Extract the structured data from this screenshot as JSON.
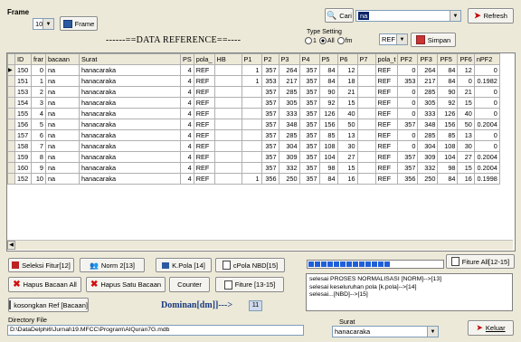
{
  "top": {
    "frame_label": "Frame",
    "frame_count": "10",
    "frame_button": "Frame",
    "cari_button": "Cari",
    "search_value": "na",
    "refresh_button": "Refresh",
    "data_reference_title": "------==DATA REFERENCE==----",
    "type_setting_label": "Type Setting",
    "radio_1": "1",
    "radio_all": "All",
    "radio_fm": "fm",
    "ref_select": "REF",
    "simpan_button": "Simpan"
  },
  "table": {
    "columns": [
      "ID",
      "frar",
      "bacaan",
      "Surat",
      "PS",
      "pola_",
      "HB",
      "P1",
      "P2",
      "P3",
      "P4",
      "P5",
      "P6",
      "P7",
      "pola_t",
      "PF2",
      "PF3",
      "PF5",
      "PF6",
      "nPF2"
    ],
    "rows": [
      [
        "150",
        "0",
        "na",
        "hanacaraka",
        "4",
        "REF",
        "",
        "1",
        "357",
        "264",
        "357",
        "84",
        "12",
        "",
        "REF",
        "0",
        "264",
        "84",
        "12",
        "0"
      ],
      [
        "151",
        "1",
        "na",
        "hanacaraka",
        "4",
        "REF",
        "",
        "1",
        "353",
        "217",
        "357",
        "84",
        "18",
        "",
        "REF",
        "353",
        "217",
        "84",
        "0",
        "0.1982"
      ],
      [
        "153",
        "2",
        "na",
        "hanacaraka",
        "4",
        "REF",
        "",
        "",
        "357",
        "285",
        "357",
        "90",
        "21",
        "",
        "REF",
        "0",
        "285",
        "90",
        "21",
        "0"
      ],
      [
        "154",
        "3",
        "na",
        "hanacaraka",
        "4",
        "REF",
        "",
        "",
        "357",
        "305",
        "357",
        "92",
        "15",
        "",
        "REF",
        "0",
        "305",
        "92",
        "15",
        "0"
      ],
      [
        "155",
        "4",
        "na",
        "hanacaraka",
        "4",
        "REF",
        "",
        "",
        "357",
        "333",
        "357",
        "126",
        "40",
        "",
        "REF",
        "0",
        "333",
        "126",
        "40",
        "0"
      ],
      [
        "156",
        "5",
        "na",
        "hanacaraka",
        "4",
        "REF",
        "",
        "",
        "357",
        "348",
        "357",
        "156",
        "50",
        "",
        "REF",
        "357",
        "348",
        "156",
        "50",
        "0.2004"
      ],
      [
        "157",
        "6",
        "na",
        "hanacaraka",
        "4",
        "REF",
        "",
        "",
        "357",
        "285",
        "357",
        "85",
        "13",
        "",
        "REF",
        "0",
        "285",
        "85",
        "13",
        "0"
      ],
      [
        "158",
        "7",
        "na",
        "hanacaraka",
        "4",
        "REF",
        "",
        "",
        "357",
        "304",
        "357",
        "108",
        "30",
        "",
        "REF",
        "0",
        "304",
        "108",
        "30",
        "0"
      ],
      [
        "159",
        "8",
        "na",
        "hanacaraka",
        "4",
        "REF",
        "",
        "",
        "357",
        "309",
        "357",
        "104",
        "27",
        "",
        "REF",
        "357",
        "309",
        "104",
        "27",
        "0.2004"
      ],
      [
        "160",
        "9",
        "na",
        "hanacaraka",
        "4",
        "REF",
        "",
        "",
        "357",
        "332",
        "357",
        "98",
        "15",
        "",
        "REF",
        "357",
        "332",
        "98",
        "15",
        "0.2004"
      ],
      [
        "152",
        "10",
        "na",
        "hanacaraka",
        "4",
        "REF",
        "",
        "1",
        "356",
        "250",
        "357",
        "84",
        "16",
        "",
        "REF",
        "356",
        "250",
        "84",
        "16",
        "0.1998"
      ]
    ]
  },
  "buttons": {
    "seleksi": "Seleksi Fitur[12]",
    "norm": "Norm 2[13]",
    "kpola": "K.Pola [14]",
    "cpola": "cPola NBD[15]",
    "fiture_all": "Fiture All[12-15]",
    "hapus_all": "Hapus Bacaan All",
    "hapus_satu": "Hapus Satu Bacaan",
    "counter": "Counter",
    "fiture": "Fiture [13-15]",
    "kosongkan": "kosongkan Ref [Bacaan]",
    "keluar": "Keluar"
  },
  "progress": {
    "segments_filled": 13,
    "segments_total": 21
  },
  "log": {
    "lines": [
      "selesai PROSES NORMALISASI [NORM]-->[13]",
      "selesai keseluruhan pola [k.pola]-->[14]",
      "selesai...[NBD]-->[15]"
    ]
  },
  "dominan": {
    "label": "Dominan[dm]]--->",
    "value": "11"
  },
  "directory": {
    "label": "Directory File",
    "path": "D:\\DataDelphi6\\Jurnal\\19.MFCC\\Program\\AlQuran7G.mdb"
  },
  "surat": {
    "label": "Surat",
    "value": "hanacaraka"
  },
  "colors": {
    "accent_blue": "#1f5fd8",
    "selection": "#0a246a",
    "red_x": "#d01010"
  }
}
